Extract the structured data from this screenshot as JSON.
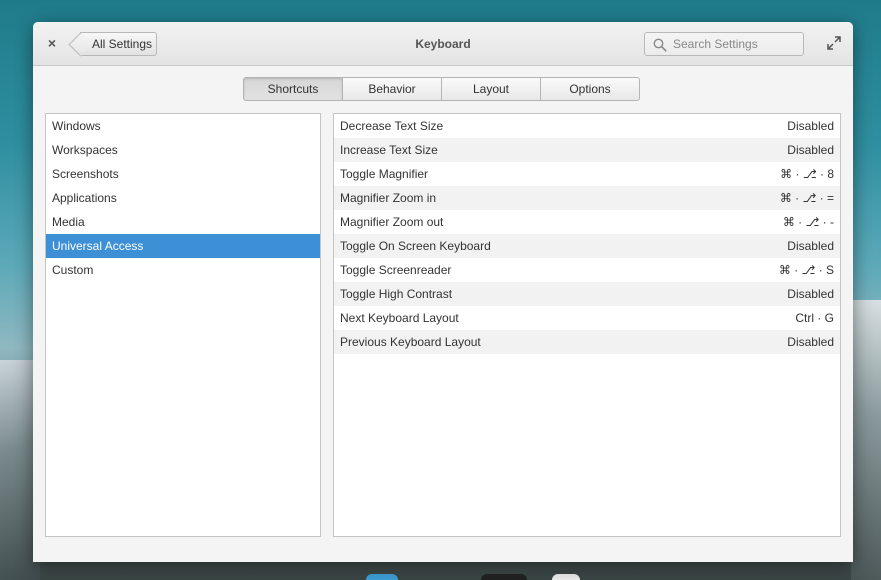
{
  "window": {
    "title": "Keyboard",
    "back_label": "All Settings",
    "close_glyph": "×",
    "search_placeholder": "Search Settings"
  },
  "tabs": [
    {
      "label": "Shortcuts",
      "active": true
    },
    {
      "label": "Behavior",
      "active": false
    },
    {
      "label": "Layout",
      "active": false
    },
    {
      "label": "Options",
      "active": false
    }
  ],
  "sidebar": {
    "items": [
      {
        "label": "Windows"
      },
      {
        "label": "Workspaces"
      },
      {
        "label": "Screenshots"
      },
      {
        "label": "Applications"
      },
      {
        "label": "Media"
      },
      {
        "label": "Universal Access",
        "selected": true
      },
      {
        "label": "Custom"
      }
    ]
  },
  "shortcuts": [
    {
      "name": "Decrease Text Size",
      "accel": "Disabled"
    },
    {
      "name": "Increase Text Size",
      "accel": "Disabled"
    },
    {
      "name": "Toggle Magnifier",
      "accel": "⌘ · ⎇ · 8"
    },
    {
      "name": "Magnifier Zoom in",
      "accel": "⌘ · ⎇ · ="
    },
    {
      "name": "Magnifier Zoom out",
      "accel": "⌘ · ⎇ · -"
    },
    {
      "name": "Toggle On Screen Keyboard",
      "accel": "Disabled"
    },
    {
      "name": "Toggle Screenreader",
      "accel": "⌘ · ⎇ · S"
    },
    {
      "name": "Toggle High Contrast",
      "accel": "Disabled"
    },
    {
      "name": "Next Keyboard Layout",
      "accel": "Ctrl · G"
    },
    {
      "name": "Previous Keyboard Layout",
      "accel": "Disabled"
    }
  ],
  "colors": {
    "selection": "#3d8fd6",
    "row_alt": "#f2f2f2"
  },
  "icons": {
    "search": "search-icon",
    "maximize": "maximize-icon",
    "back": "back-arrow-icon"
  }
}
